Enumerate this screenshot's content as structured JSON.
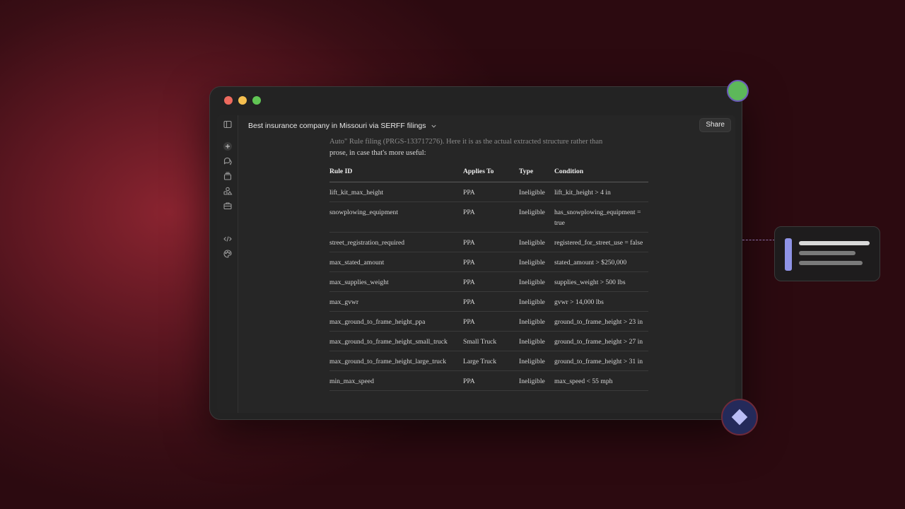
{
  "window": {
    "conversation_title": "Best insurance company in Missouri via SERFF filings",
    "share_label": "Share"
  },
  "sidebar": {
    "icons": [
      "sidebar-toggle-icon",
      "new-chat-icon",
      "chats-icon",
      "projects-icon",
      "artifacts-icon",
      "briefcase-icon",
      "code-icon",
      "palette-icon"
    ]
  },
  "message": {
    "intro_faded": "Auto\" Rule filing (PRGS-133717276). Here it is as the actual extracted structure rather than",
    "intro": "prose, in case that's more useful:"
  },
  "table": {
    "headers": [
      "Rule ID",
      "Applies To",
      "Type",
      "Condition"
    ],
    "rows": [
      [
        "lift_kit_max_height",
        "PPA",
        "Ineligible",
        "lift_kit_height > 4 in"
      ],
      [
        "snowplowing_equipment",
        "PPA",
        "Ineligible",
        "has_snowplowing_equipment = true"
      ],
      [
        "street_registration_required",
        "PPA",
        "Ineligible",
        "registered_for_street_use = false"
      ],
      [
        "max_stated_amount",
        "PPA",
        "Ineligible",
        "stated_amount > $250,000"
      ],
      [
        "max_supplies_weight",
        "PPA",
        "Ineligible",
        "supplies_weight > 500 lbs"
      ],
      [
        "max_gvwr",
        "PPA",
        "Ineligible",
        "gvwr > 14,000 lbs"
      ],
      [
        "max_ground_to_frame_height_ppa",
        "PPA",
        "Ineligible",
        "ground_to_frame_height > 23 in"
      ],
      [
        "max_ground_to_frame_height_small_truck",
        "Small Truck",
        "Ineligible",
        "ground_to_frame_height > 27 in"
      ],
      [
        "max_ground_to_frame_height_large_truck",
        "Large Truck",
        "Ineligible",
        "ground_to_frame_height > 31 in"
      ],
      [
        "min_max_speed",
        "PPA",
        "Ineligible",
        "max_speed < 55 mph"
      ]
    ]
  },
  "colors": {
    "accent_purple": "#8f93e6",
    "avatar_green": "#5db85a",
    "badge_navy": "#242a5a"
  }
}
